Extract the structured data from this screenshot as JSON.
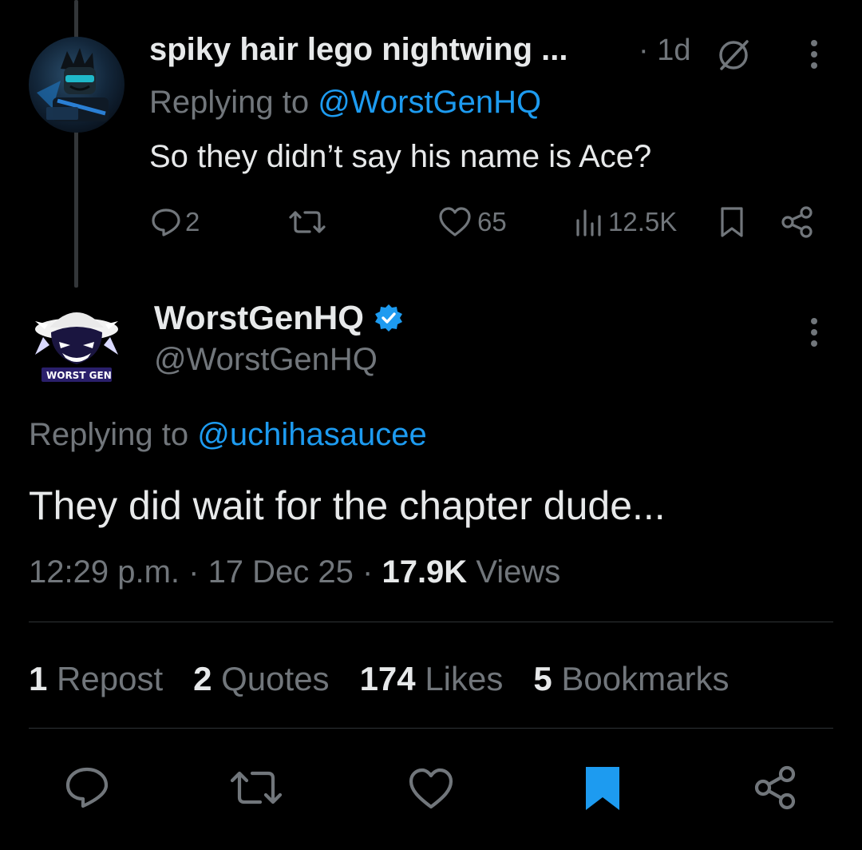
{
  "parent_tweet": {
    "display_name": "spiky hair lego nightwing ...",
    "time": "· 1d",
    "replying_prefix": "Replying to ",
    "replying_handle": "@WorstGenHQ",
    "text": "So they didn’t say his name is Ace?",
    "replies": "2",
    "likes": "65",
    "views": "12.5K"
  },
  "main_tweet": {
    "display_name": "WorstGenHQ",
    "handle": "@WorstGenHQ",
    "avatar_text": "WORST GEN",
    "replying_prefix": "Replying to ",
    "replying_handle": "@uchihasaucee",
    "text": "They did wait for the chapter dude...",
    "time": "12:29 p.m.",
    "sep1": " · ",
    "date": "17 Dec 25",
    "sep2": " · ",
    "views_count": "17.9K",
    "views_label": " Views"
  },
  "stats": {
    "reposts_count": "1",
    "reposts_label": "Repost",
    "quotes_count": "2",
    "quotes_label": "Quotes",
    "likes_count": "174",
    "likes_label": "Likes",
    "bookmarks_count": "5",
    "bookmarks_label": "Bookmarks"
  },
  "colors": {
    "accent": "#1d9bf0",
    "muted": "#71767b",
    "text": "#e7e9ea",
    "background": "#000000"
  },
  "icons": [
    "reply-icon",
    "repost-icon",
    "like-icon",
    "views-icon",
    "bookmark-icon",
    "share-icon",
    "more-icon",
    "verified-badge-icon",
    "muted-icon"
  ]
}
